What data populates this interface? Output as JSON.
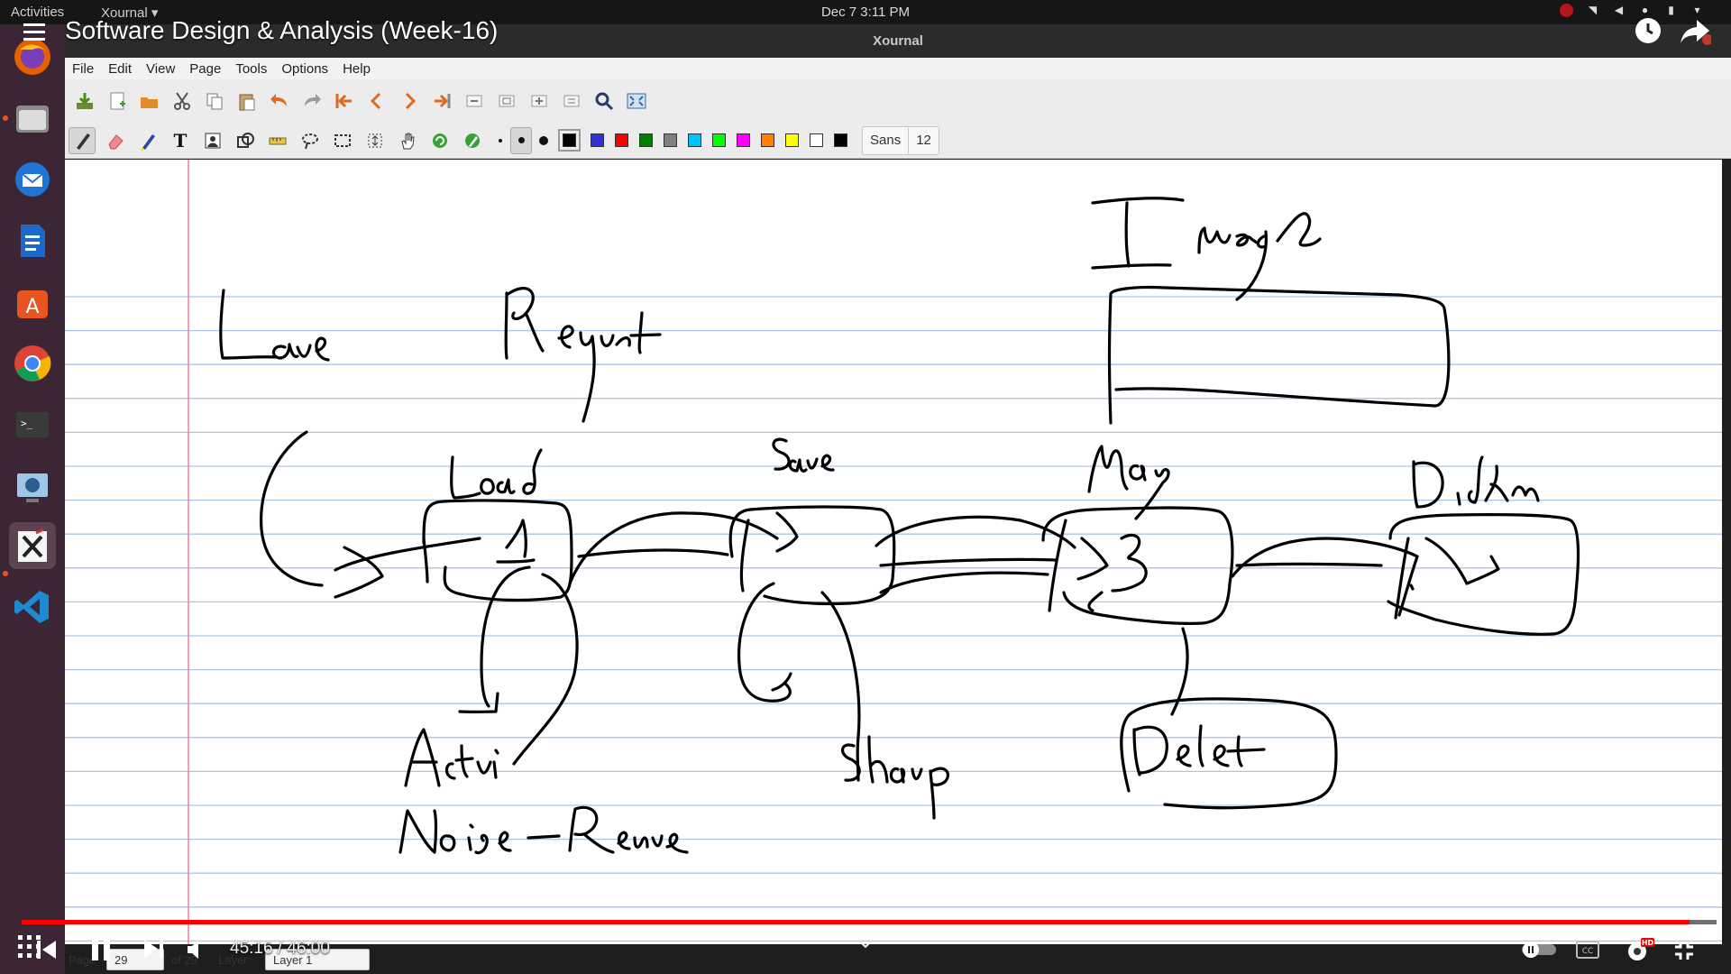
{
  "system_bar": {
    "activities": "Activities",
    "app_menu": "Xournal",
    "clock": "Dec 7  3:11 PM"
  },
  "video": {
    "title": "Software Design & Analysis (Week-16)",
    "time": "45:16 / 46:00",
    "progress": 0.984
  },
  "window": {
    "title": "Xournal"
  },
  "menu": [
    "File",
    "Edit",
    "View",
    "Page",
    "Tools",
    "Options",
    "Help"
  ],
  "toolbar": {
    "font_name": "Sans",
    "font_size": "12",
    "palette": [
      "#000000",
      "#3333cc",
      "#ff0000",
      "#008000",
      "#808080",
      "#00c0ff",
      "#00ff00",
      "#ff00ff",
      "#ff8000",
      "#ffff00",
      "#ffffff",
      "#000000"
    ]
  },
  "status": {
    "page_label": "Page",
    "page_value": "29",
    "of_label": "of 29",
    "layer_label": "Layer:",
    "layer_value": "Layer 1"
  },
  "dock": [
    "firefox-icon",
    "files-icon",
    "thunderbird-icon",
    "writer-icon",
    "software-center-icon",
    "chrome-icon",
    "terminal-icon",
    "screenshot-icon",
    "xournal-icon",
    "vscode-icon"
  ]
}
